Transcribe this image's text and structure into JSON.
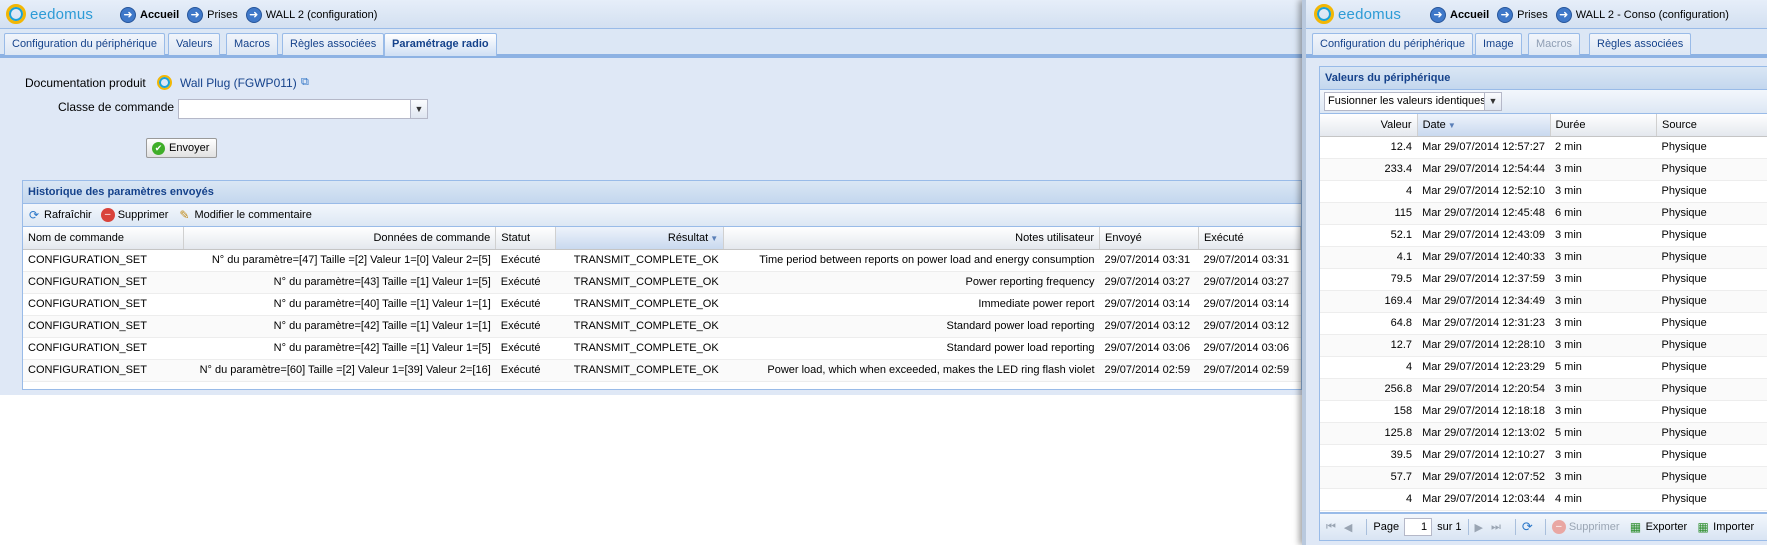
{
  "left": {
    "brand": "eedomus",
    "breadcrumb": [
      {
        "label": "Accueil",
        "bold": true
      },
      {
        "label": "Prises",
        "bold": false
      },
      {
        "label": "WALL 2 (configuration)",
        "bold": false
      }
    ],
    "tabs": [
      {
        "label": "Configuration du périphérique"
      },
      {
        "label": "Valeurs"
      },
      {
        "label": "Macros"
      },
      {
        "label": "Règles associées"
      },
      {
        "label": "Paramétrage radio"
      }
    ],
    "active_tab": "Paramétrage radio",
    "doc_label": "Documentation produit",
    "doc_link": "Wall Plug (FGWP011)",
    "class_label": "Classe de commande",
    "class_value": "",
    "send_button": "Envoyer",
    "history": {
      "title": "Historique des paramètres envoyés",
      "toolbar": {
        "refresh": "Rafraîchir",
        "delete": "Supprimer",
        "edit_comment": "Modifier le commentaire"
      },
      "columns": [
        "Nom de commande",
        "Données de commande",
        "Statut",
        "Résultat",
        "Notes utilisateur",
        "Envoyé",
        "Exécuté"
      ],
      "rows": [
        [
          "CONFIGURATION_SET",
          "N° du paramètre=[47] Taille =[2] Valeur 1=[0] Valeur 2=[5]",
          "Exécuté",
          "TRANSMIT_COMPLETE_OK",
          "Time period between reports on power load and energy consumption",
          "29/07/2014 03:31",
          "29/07/2014 03:31"
        ],
        [
          "CONFIGURATION_SET",
          "N° du paramètre=[43] Taille =[1] Valeur 1=[5]",
          "Exécuté",
          "TRANSMIT_COMPLETE_OK",
          "Power reporting frequency",
          "29/07/2014 03:27",
          "29/07/2014 03:27"
        ],
        [
          "CONFIGURATION_SET",
          "N° du paramètre=[40] Taille =[1] Valeur 1=[1]",
          "Exécuté",
          "TRANSMIT_COMPLETE_OK",
          "Immediate power report",
          "29/07/2014 03:14",
          "29/07/2014 03:14"
        ],
        [
          "CONFIGURATION_SET",
          "N° du paramètre=[42] Taille =[1] Valeur 1=[1]",
          "Exécuté",
          "TRANSMIT_COMPLETE_OK",
          "Standard power load reporting",
          "29/07/2014 03:12",
          "29/07/2014 03:12"
        ],
        [
          "CONFIGURATION_SET",
          "N° du paramètre=[42] Taille =[1] Valeur 1=[5]",
          "Exécuté",
          "TRANSMIT_COMPLETE_OK",
          "Standard power load reporting",
          "29/07/2014 03:06",
          "29/07/2014 03:06"
        ],
        [
          "CONFIGURATION_SET",
          "N° du paramètre=[60] Taille =[2] Valeur 1=[39] Valeur 2=[16]",
          "Exécuté",
          "TRANSMIT_COMPLETE_OK",
          "Power load, which when exceeded, makes the LED ring flash violet",
          "29/07/2014 02:59",
          "29/07/2014 02:59"
        ]
      ]
    }
  },
  "right": {
    "brand": "eedomus",
    "breadcrumb": [
      {
        "label": "Accueil",
        "bold": true
      },
      {
        "label": "Prises",
        "bold": false
      },
      {
        "label": "WALL 2 - Conso (configuration)",
        "bold": false
      }
    ],
    "tabs": [
      {
        "label": "Configuration du périphérique",
        "disabled": false
      },
      {
        "label": "Image",
        "disabled": false
      },
      {
        "label": "Macros",
        "disabled": true
      },
      {
        "label": "Règles associées",
        "disabled": false
      }
    ],
    "panel_title": "Valeurs du périphérique",
    "merge_select": "Fusionner les valeurs identiques",
    "columns": [
      "Valeur",
      "Date",
      "Durée",
      "Source"
    ],
    "rows": [
      [
        "12.4",
        "Mar 29/07/2014 12:57:27",
        "2 min",
        "Physique"
      ],
      [
        "233.4",
        "Mar 29/07/2014 12:54:44",
        "3 min",
        "Physique"
      ],
      [
        "4",
        "Mar 29/07/2014 12:52:10",
        "3 min",
        "Physique"
      ],
      [
        "115",
        "Mar 29/07/2014 12:45:48",
        "6 min",
        "Physique"
      ],
      [
        "52.1",
        "Mar 29/07/2014 12:43:09",
        "3 min",
        "Physique"
      ],
      [
        "4.1",
        "Mar 29/07/2014 12:40:33",
        "3 min",
        "Physique"
      ],
      [
        "79.5",
        "Mar 29/07/2014 12:37:59",
        "3 min",
        "Physique"
      ],
      [
        "169.4",
        "Mar 29/07/2014 12:34:49",
        "3 min",
        "Physique"
      ],
      [
        "64.8",
        "Mar 29/07/2014 12:31:23",
        "3 min",
        "Physique"
      ],
      [
        "12.7",
        "Mar 29/07/2014 12:28:10",
        "3 min",
        "Physique"
      ],
      [
        "4",
        "Mar 29/07/2014 12:23:29",
        "5 min",
        "Physique"
      ],
      [
        "256.8",
        "Mar 29/07/2014 12:20:54",
        "3 min",
        "Physique"
      ],
      [
        "158",
        "Mar 29/07/2014 12:18:18",
        "3 min",
        "Physique"
      ],
      [
        "125.8",
        "Mar 29/07/2014 12:13:02",
        "5 min",
        "Physique"
      ],
      [
        "39.5",
        "Mar 29/07/2014 12:10:27",
        "3 min",
        "Physique"
      ],
      [
        "57.7",
        "Mar 29/07/2014 12:07:52",
        "3 min",
        "Physique"
      ],
      [
        "4",
        "Mar 29/07/2014 12:03:44",
        "4 min",
        "Physique"
      ]
    ],
    "pager": {
      "page_label": "Page",
      "page_value": "1",
      "of_label": "sur 1",
      "delete": "Supprimer",
      "export": "Exporter",
      "import": "Importer"
    }
  },
  "icons": {
    "nav_arrow": "right-arrow-circle-icon",
    "doc": "magnifier-icon",
    "external": "external-link-icon",
    "refresh": "refresh-icon",
    "delete": "delete-icon",
    "edit": "pencil-icon",
    "send": "check-icon"
  },
  "colors": {
    "accent": "#15428b",
    "brand": "#2d9bd6",
    "panel": "#dfe8f6"
  }
}
